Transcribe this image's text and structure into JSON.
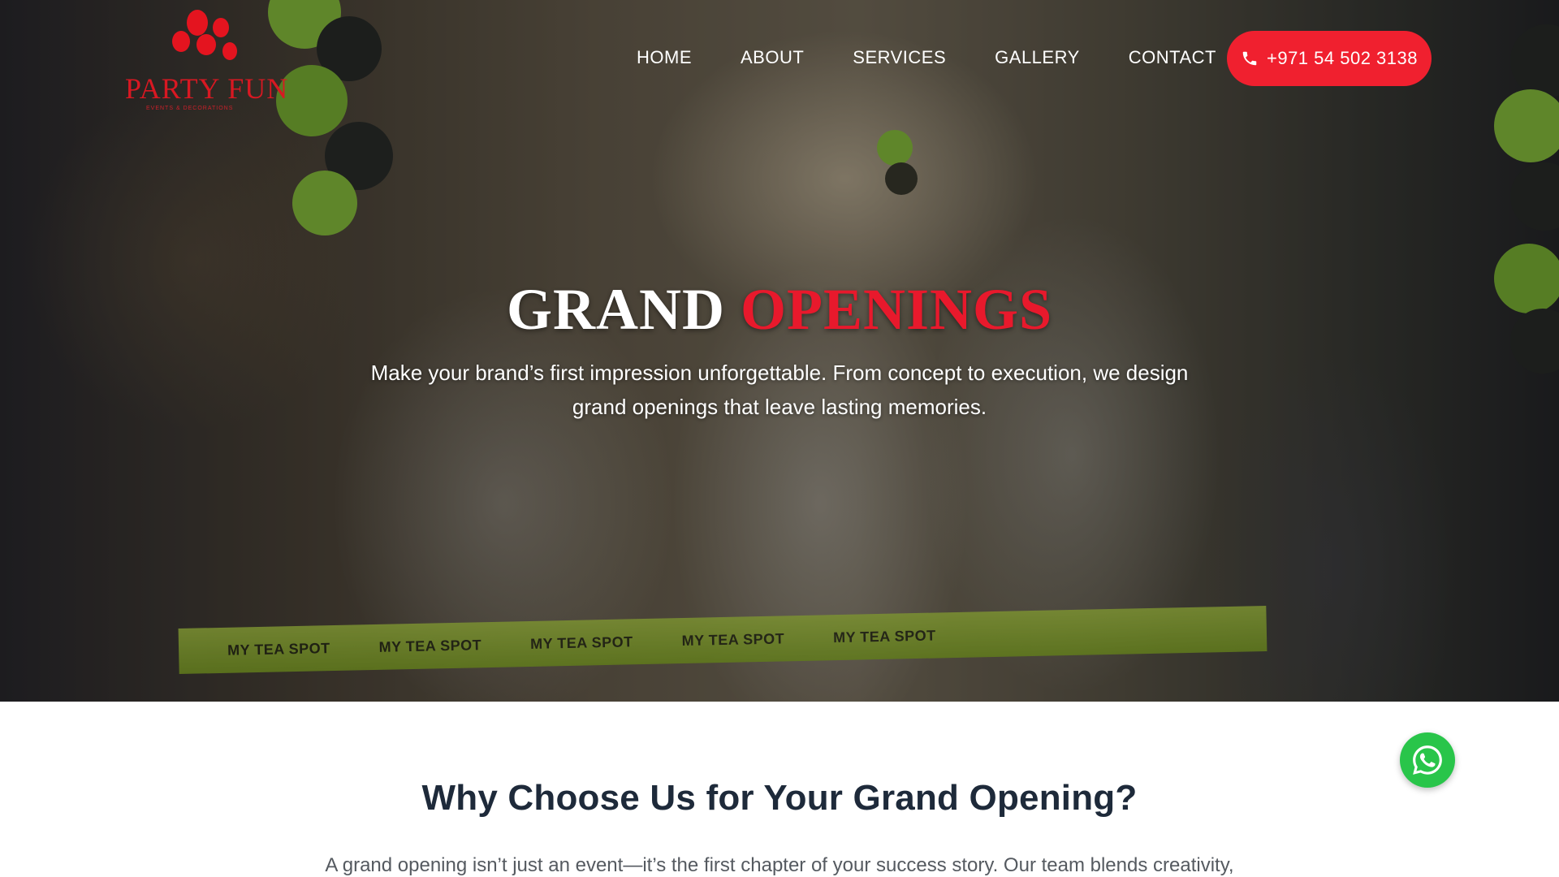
{
  "brand": {
    "name": "PARTY FUN",
    "tagline": "EVENTS & DECORATIONS",
    "color": "#e4141f"
  },
  "nav": {
    "items": [
      {
        "label": "HOME"
      },
      {
        "label": "ABOUT"
      },
      {
        "label": "SERVICES"
      },
      {
        "label": "GALLERY"
      },
      {
        "label": "CONTACT"
      }
    ],
    "phone": "+971 54 502 3138",
    "phone_color": "#f0202f"
  },
  "hero": {
    "title_word1": "GRAND",
    "title_word2": "OPENINGS",
    "subtitle": "Make your brand’s first impression unforgettable. From concept to execution, we design grand openings that leave lasting memories.",
    "ribbon_text": "MY TEA SPOT",
    "accent_color": "#e8192c"
  },
  "section": {
    "title": "Why Choose Us for Your Grand Opening?",
    "text": "A grand opening isn’t just an event—it’s the first chapter of your success story. Our team blends creativity,"
  },
  "whatsapp": {
    "icon": "whatsapp-icon",
    "color": "#29c54a"
  }
}
